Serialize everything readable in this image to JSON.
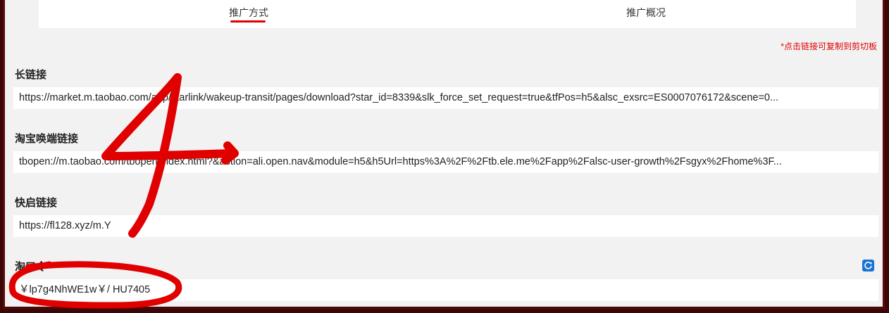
{
  "tabs": {
    "promo": "推广方式",
    "overview": "推广概况"
  },
  "copy_hint": "*点击链接可复制到剪切板",
  "sections": {
    "long_link": {
      "label": "长链接",
      "value": "https://market.m.taobao.com/app/starlink/wakeup-transit/pages/download?star_id=8339&slk_force_set_request=true&tfPos=h5&alsc_exsrc=ES0007076172&scene=0..."
    },
    "taobao_wake": {
      "label": "淘宝唤端链接",
      "value": "tbopen://m.taobao.com/tbopen/index.html?&action=ali.open.nav&module=h5&h5Url=https%3A%2F%2Ftb.ele.me%2Fapp%2Falsc-user-growth%2Fsgyx%2Fhome%3F..."
    },
    "quick_link": {
      "label": "快启链接",
      "value": "https://fl128.xyz/m.Y"
    },
    "taokouling": {
      "label": "淘口令",
      "value": "￥lp7g4NhWE1w￥/ HU7405"
    }
  },
  "annotation": {
    "number": "4",
    "color": "#e00000"
  }
}
